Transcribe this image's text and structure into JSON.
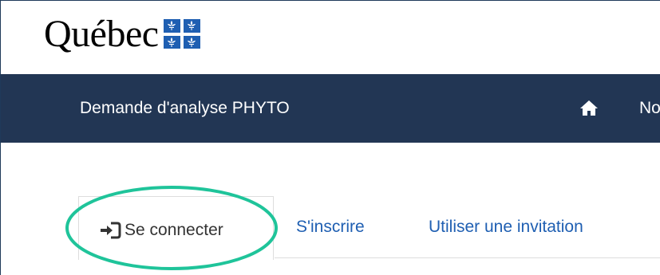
{
  "header": {
    "logo_text": "Québec",
    "flag_icon": "quebec-flag-icon",
    "flag_color": "#1f5fb2"
  },
  "navbar": {
    "title": "Demande d'analyse PHYTO",
    "home_icon": "home-icon",
    "truncated_item": "No",
    "background": "#223654"
  },
  "tabs": {
    "signin_icon": "sign-in-icon",
    "signin_label": "Se connecter",
    "register_label": "S'inscrire",
    "invitation_label": "Utiliser une invitation",
    "link_color": "#1f5fb2"
  },
  "annotation": {
    "highlight_color": "#1fc49a"
  }
}
